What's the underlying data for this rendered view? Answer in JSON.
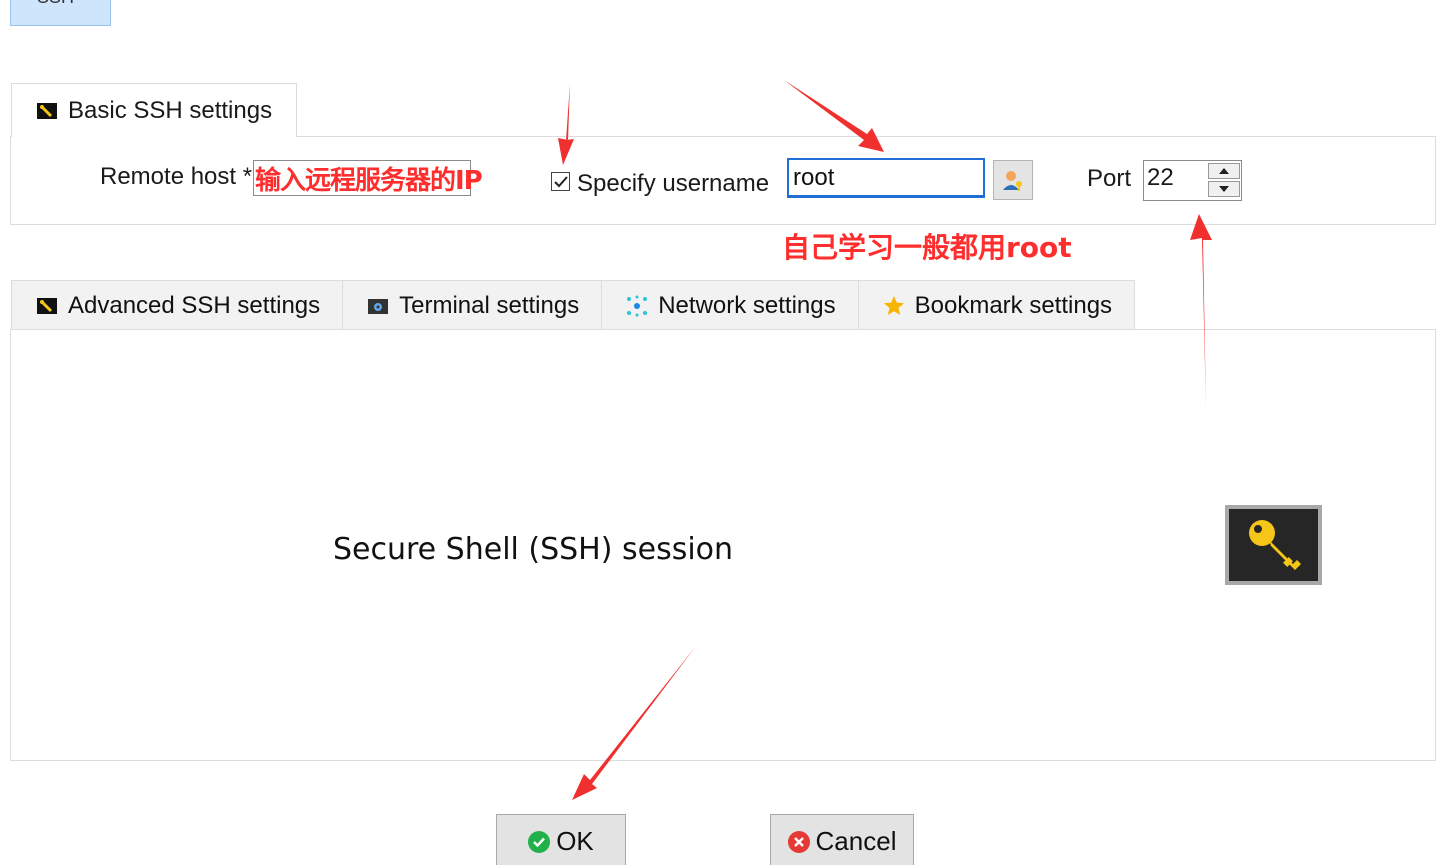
{
  "top_strip": {
    "selected_session": "SSH"
  },
  "basic_tab": {
    "label": "Basic SSH settings"
  },
  "basic": {
    "remote_host_label": "Remote host *",
    "remote_host_value": "",
    "remote_host_annotation": "输入远程服务器的IP",
    "specify_username_label": "Specify username",
    "specify_username_checked": true,
    "username_value": "root",
    "username_annotation": "自己学习一般都用root",
    "port_label": "Port",
    "port_value": "22"
  },
  "tabs": [
    {
      "label": "Advanced SSH settings",
      "icon": "ssh-settings-icon"
    },
    {
      "label": "Terminal settings",
      "icon": "terminal-icon"
    },
    {
      "label": "Network settings",
      "icon": "network-icon"
    },
    {
      "label": "Bookmark settings",
      "icon": "star-icon"
    }
  ],
  "session_description": "Secure Shell (SSH) session",
  "buttons": {
    "ok": "OK",
    "cancel": "Cancel"
  },
  "colors": {
    "annotation_red": "#ff2e2e",
    "focus_blue": "#1f6fd6",
    "ok_green": "#22b04b",
    "cancel_red": "#e53935",
    "key_gold": "#f5c518"
  }
}
